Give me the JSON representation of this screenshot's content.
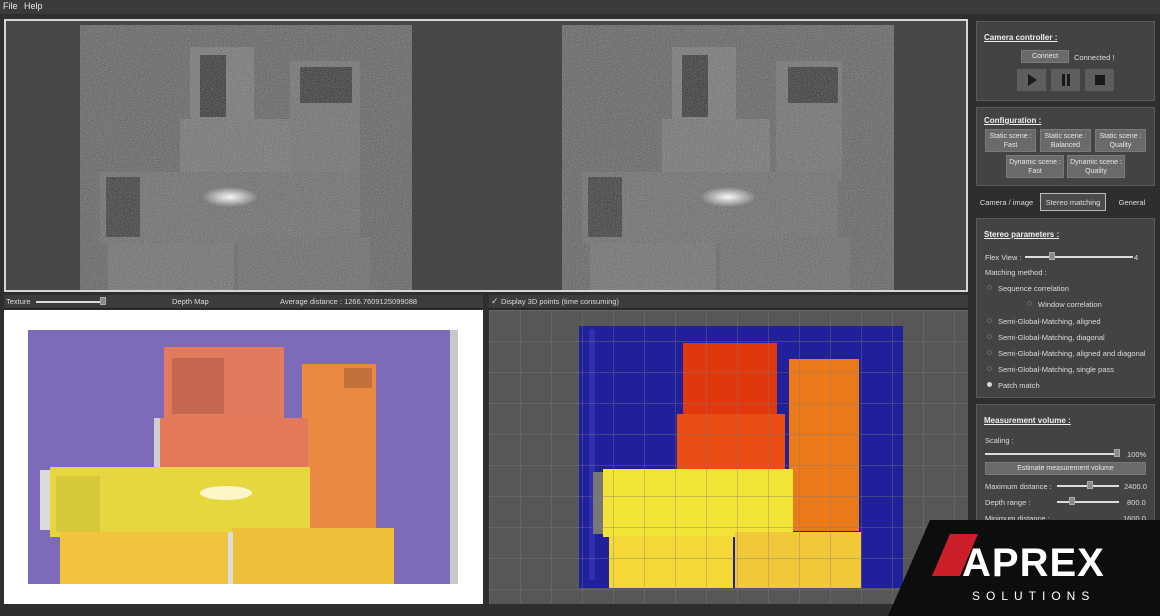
{
  "menu": {
    "file": "File",
    "help": "Help"
  },
  "bottom_left": {
    "texture_label": "Texture",
    "depth_map_label": "Depth Map",
    "average_distance": "Average distance : 1266.7609125099088",
    "texture_slider_value": 0.5
  },
  "bottom_right": {
    "display_3d_label": "Display 3D points (time consuming)",
    "display_3d_checked": true
  },
  "camera_controller": {
    "title": "Camera controller :",
    "connect_label": "Connect",
    "status": "Connected !",
    "play_icon": "play-icon",
    "pause_icon": "pause-icon",
    "stop_icon": "stop-icon"
  },
  "configuration": {
    "title": "Configuration :",
    "static_fast": "Static scene : Fast",
    "static_balanced": "Static scene : Balanced",
    "static_quality": "Static scene : Quality",
    "dynamic_fast": "Dynamic scene : Fast",
    "dynamic_quality": "Dynamic scene : Quality"
  },
  "tabs": {
    "camera_image": "Camera / image",
    "stereo_matching": "Stereo matching",
    "general": "General",
    "active": "Stereo matching"
  },
  "stereo_parameters": {
    "title": "Stereo parameters :",
    "flex_view_label": "Flex View :",
    "flex_view_value": "4",
    "matching_method_label": "Matching method :",
    "methods": [
      {
        "label": "Sequence correlation",
        "selected": false
      },
      {
        "label": "Window correlation",
        "selected": false
      },
      {
        "label": "Semi-Global-Matching, aligned",
        "selected": false
      },
      {
        "label": "Semi-Global-Matching, diagonal",
        "selected": false
      },
      {
        "label": "Semi-Global-Matching, aligned and diagonal",
        "selected": false
      },
      {
        "label": "Semi-Global-Matching, single pass",
        "selected": false
      },
      {
        "label": "Patch match",
        "selected": true
      }
    ]
  },
  "measurement_volume": {
    "title": "Measurement volume :",
    "scaling_label": "Scaling :",
    "scaling_value": "100%",
    "estimate_button": "Estimate measurement volume",
    "max_distance_label": "Maximum distance :",
    "max_distance_value": "2400.0",
    "depth_range_label": "Depth range :",
    "depth_range_value": "800.0",
    "min_distance_label": "Minimum distance :",
    "min_distance_value": "1600.0"
  },
  "logo": {
    "brand": "APREX",
    "tagline": "SOLUTIONS"
  },
  "colors": {
    "background": "#2e2e2e",
    "panel": "#434343",
    "depth_map_bg": "#7d6ab8",
    "point_cloud_bg": "#1a1a8c",
    "logo_red": "#cc1f2a"
  }
}
